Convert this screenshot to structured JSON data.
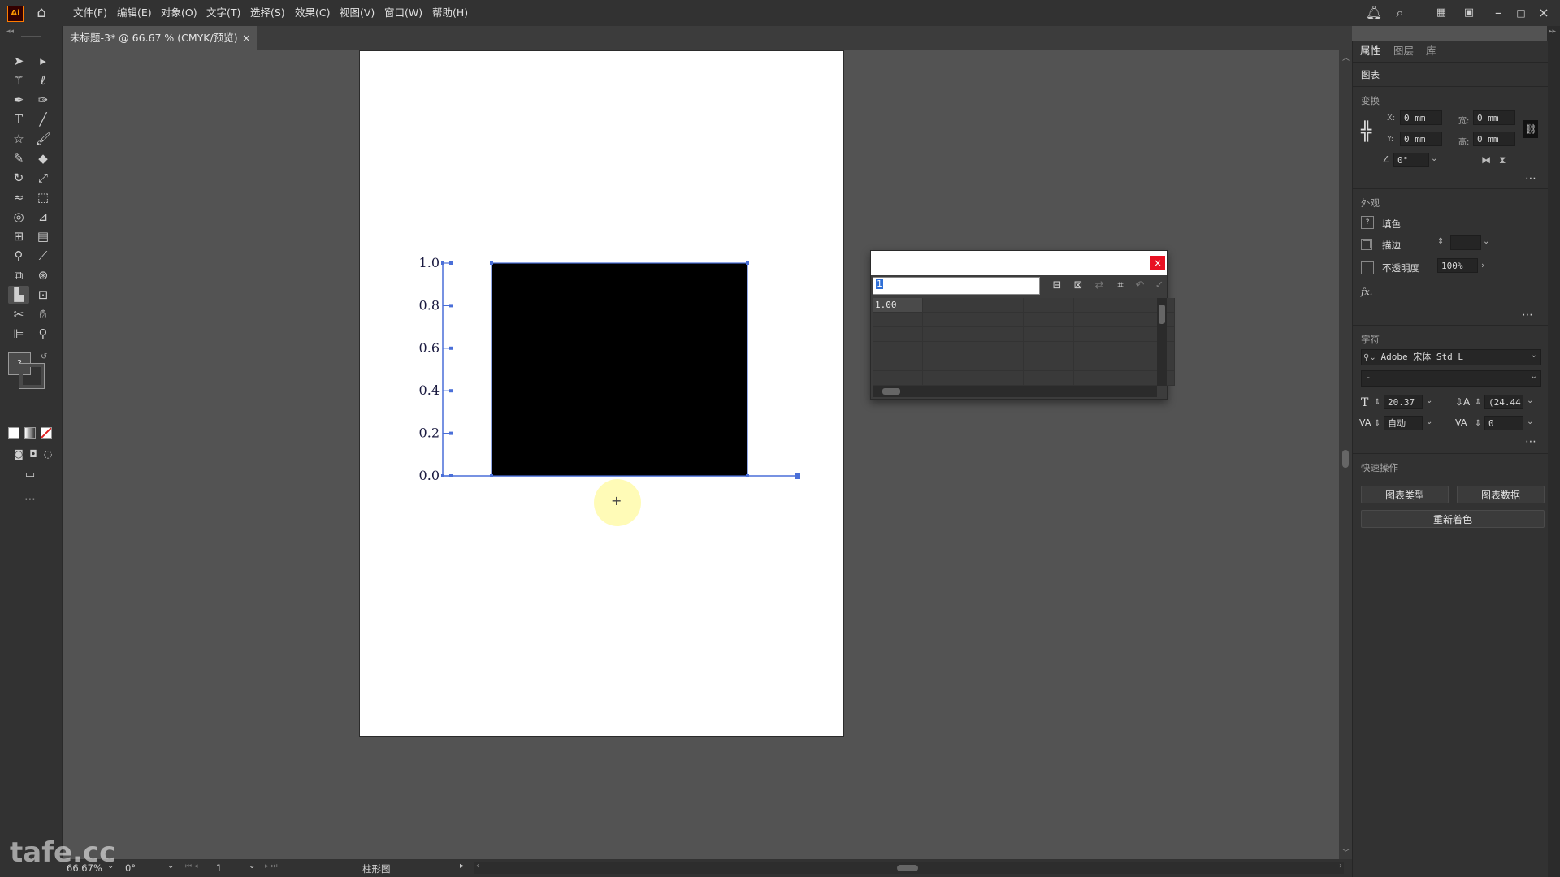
{
  "app": {
    "logo": "Ai"
  },
  "menu": [
    "文件(F)",
    "编辑(E)",
    "对象(O)",
    "文字(T)",
    "选择(S)",
    "效果(C)",
    "视图(V)",
    "窗口(W)",
    "帮助(H)"
  ],
  "document_tab": {
    "title": "未标题-3* @ 66.67 % (CMYK/预览)",
    "close": "×"
  },
  "chart": {
    "y_ticks": [
      "1.0",
      "0.8",
      "0.6",
      "0.4",
      "0.2",
      "0.0"
    ]
  },
  "chart_data": {
    "type": "bar",
    "categories": [
      ""
    ],
    "values": [
      1.0
    ],
    "title": "",
    "xlabel": "",
    "ylabel": "",
    "ylim": [
      0,
      1.0
    ],
    "bar_color": "#000000"
  },
  "graph_data_window": {
    "input_value": "1",
    "cell_value": "1.00",
    "close": "×"
  },
  "panel": {
    "tabs": [
      "属性",
      "图层",
      "库"
    ],
    "object_type": "图表",
    "transform": {
      "title": "变换",
      "x_label": "X:",
      "x_value": "0 mm",
      "y_label": "Y:",
      "y_value": "0 mm",
      "w_label": "宽:",
      "w_value": "0 mm",
      "h_label": "高:",
      "h_value": "0 mm",
      "angle_value": "0°"
    },
    "appearance": {
      "title": "外观",
      "fill_label": "填色",
      "stroke_label": "描边",
      "opacity_label": "不透明度",
      "opacity_value": "100%",
      "fx": "fx."
    },
    "character": {
      "title": "字符",
      "font_family": "Adobe 宋体 Std L",
      "font_style": "-",
      "font_size": "20.37",
      "leading": "(24.44",
      "kerning": "自动",
      "tracking": "0"
    },
    "quick_actions": {
      "title": "快速操作",
      "chart_type": "图表类型",
      "chart_data": "图表数据",
      "recolor": "重新着色"
    }
  },
  "status": {
    "zoom": "66.67%",
    "rotate": "0°",
    "artboard": "1",
    "tool_name": "柱形图"
  },
  "watermark": "tafe.cc"
}
